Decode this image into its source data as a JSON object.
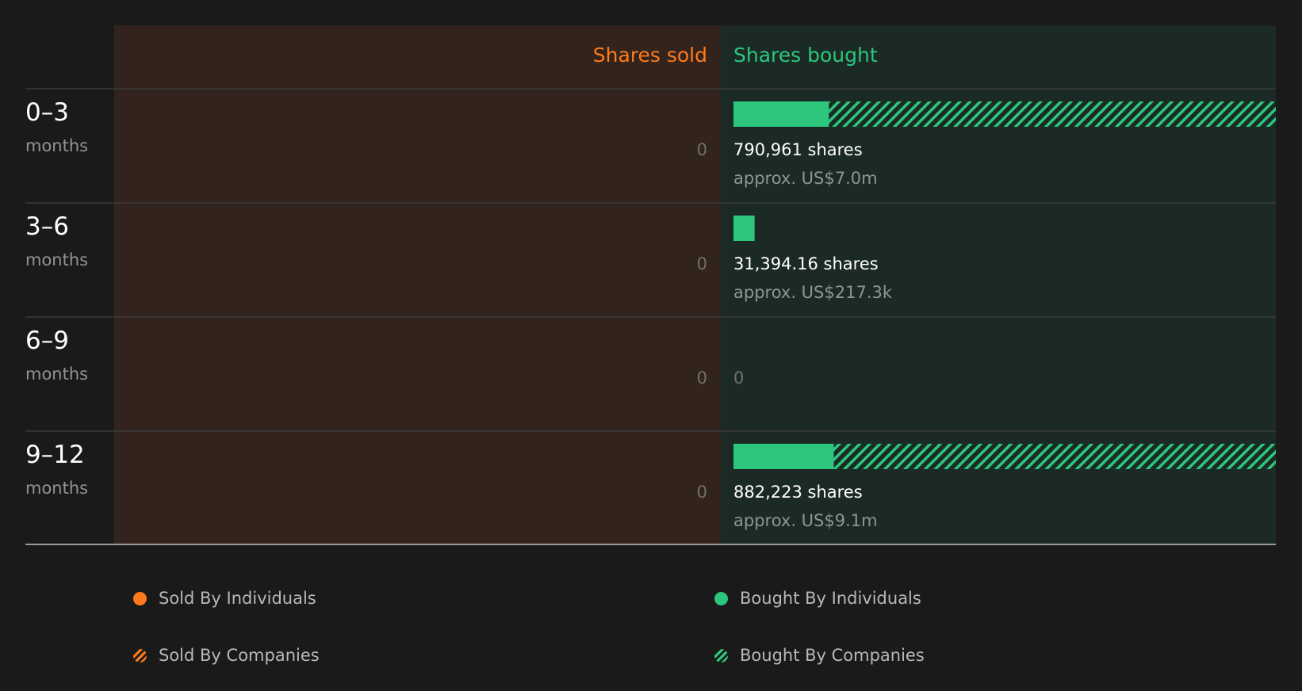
{
  "colors": {
    "background": "#1a1a1a",
    "sold_panel": "#32241c",
    "bought_panel": "#1b2a24",
    "sold_accent": "#ff7a1a",
    "bought_accent": "#2cc77d",
    "text_primary": "#ffffff",
    "text_secondary": "#8f9590",
    "zero_text": "#707070"
  },
  "headers": {
    "sold": "Shares sold",
    "bought": "Shares bought"
  },
  "chart_data": {
    "type": "bar",
    "orientation": "horizontal-diverging",
    "headers": {
      "sold": "Shares sold",
      "bought": "Shares bought"
    },
    "rows": [
      {
        "period": "0–3",
        "unit": "months",
        "sold_label": "0",
        "bought_individuals": 0.176,
        "bought_companies": 0.824,
        "bought_total_label": "790,961 shares",
        "bought_value_label": "approx. US$7.0m"
      },
      {
        "period": "3–6",
        "unit": "months",
        "sold_label": "0",
        "bought_individuals": 0.039,
        "bought_companies": 0,
        "bought_total_label": "31,394.16 shares",
        "bought_value_label": "approx. US$217.3k"
      },
      {
        "period": "6–9",
        "unit": "months",
        "sold_label": "0",
        "bought_individuals": 0,
        "bought_companies": 0,
        "bought_zero_label": "0"
      },
      {
        "period": "9–12",
        "unit": "months",
        "sold_label": "0",
        "bought_individuals": 0.185,
        "bought_companies": 0.815,
        "bought_total_label": "882,223 shares",
        "bought_value_label": "approx. US$9.1m"
      }
    ],
    "scale_note": "bar lengths are fractions of the widest bar (9–12 months total)"
  },
  "legend": {
    "sold_individuals": "Sold By Individuals",
    "bought_individuals": "Bought By Individuals",
    "sold_companies": "Sold By Companies",
    "bought_companies": "Bought By Companies"
  }
}
